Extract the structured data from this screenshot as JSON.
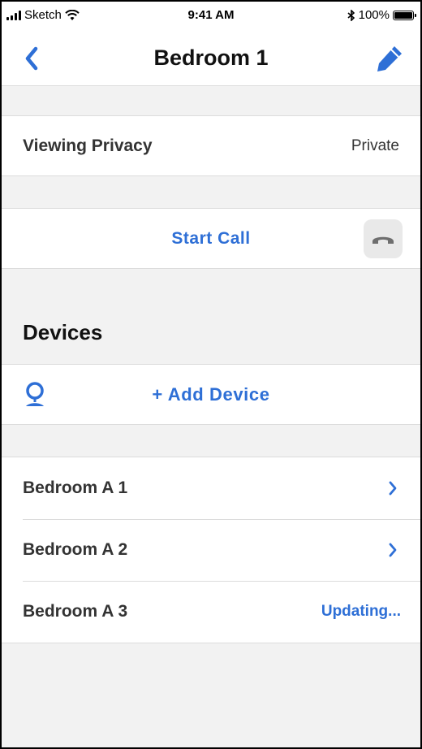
{
  "status_bar": {
    "carrier": "Sketch",
    "time": "9:41 AM",
    "battery": "100%"
  },
  "nav": {
    "title": "Bedroom 1",
    "back_icon": "chevron-left-icon",
    "edit_icon": "pencil-icon"
  },
  "privacy": {
    "label": "Viewing Privacy",
    "value": "Private"
  },
  "call": {
    "label": "Start Call",
    "icon": "phone-hangup-icon"
  },
  "devices": {
    "header": "Devices",
    "add_label": "+ Add Device",
    "add_icon": "camera-icon",
    "items": [
      {
        "name": "Bedroom A 1",
        "status": ""
      },
      {
        "name": "Bedroom A 2",
        "status": ""
      },
      {
        "name": "Bedroom A 3",
        "status": "Updating..."
      }
    ]
  },
  "colors": {
    "accent": "#2e6fd6",
    "background": "#f2f2f2"
  }
}
